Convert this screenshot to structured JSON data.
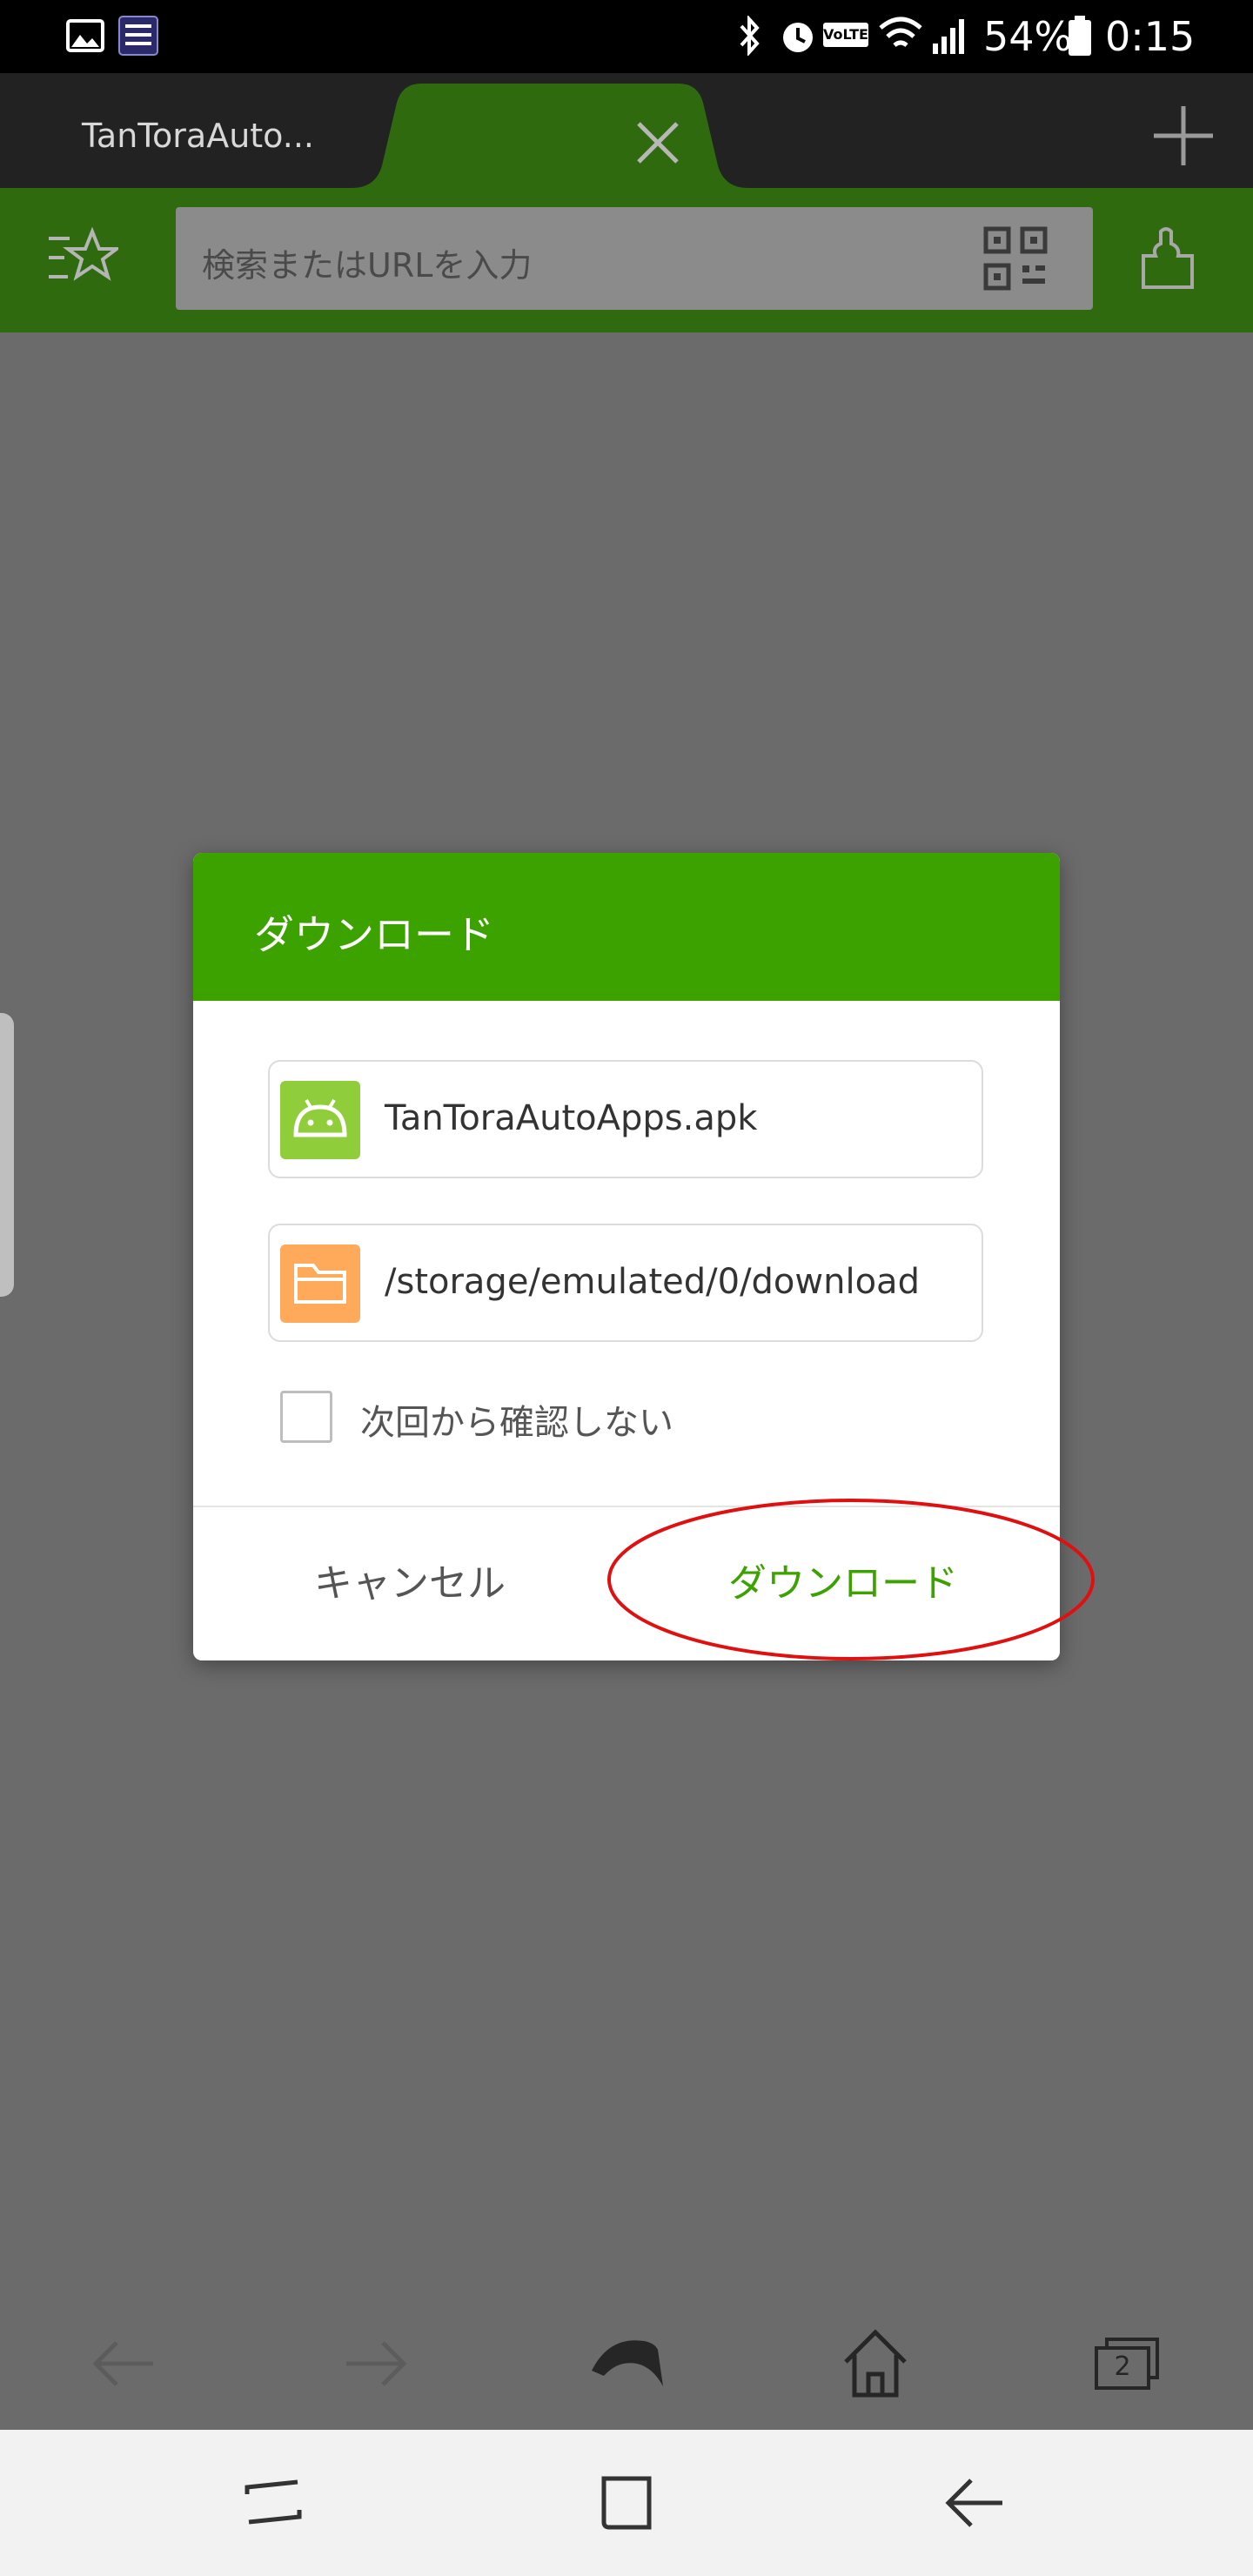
{
  "status_bar": {
    "notification_icons": [
      "image-icon",
      "fast-download-icon"
    ],
    "system_icons": [
      "bluetooth-icon",
      "alarm-icon",
      "volte-icon",
      "wifi-icon",
      "signal-icon",
      "battery-icon"
    ],
    "volte_label": "VoLTE",
    "battery_percent": "54%",
    "time": "0:15"
  },
  "tabs": {
    "inactive_tab_title": "TanToraAuto...",
    "active_tab_close_icon": "close-icon",
    "new_tab_icon": "plus-icon"
  },
  "toolbar": {
    "bookmarks_icon": "bookmark-star-icon",
    "url_placeholder": "検索またはURLを入力",
    "qr_icon": "qr-code-icon",
    "addons_icon": "puzzle-icon"
  },
  "dialog": {
    "title": "ダウンロード",
    "file_name": "TanToraAutoApps.apk",
    "file_icon": "android-icon",
    "path": "/storage/emulated/0/download",
    "path_icon": "folder-icon",
    "checkbox_label": "次回から確認しない",
    "checkbox_checked": false,
    "cancel_label": "キャンセル",
    "download_label": "ダウンロード"
  },
  "bottom_toolbar": {
    "icons": [
      "back-arrow-icon",
      "forward-arrow-icon",
      "dolphin-menu-icon",
      "home-icon",
      "tabs-icon"
    ],
    "tab_count": "2"
  },
  "system_nav": {
    "icons": [
      "recent-apps-icon",
      "home-square-icon",
      "back-icon"
    ]
  },
  "colors": {
    "accent_green": "#3ca200",
    "toolbar_green": "#2f6b0e",
    "annotation_red": "#e01010",
    "file_icon_bg": "#8fcd3a",
    "folder_icon_bg": "#ffa95a"
  }
}
